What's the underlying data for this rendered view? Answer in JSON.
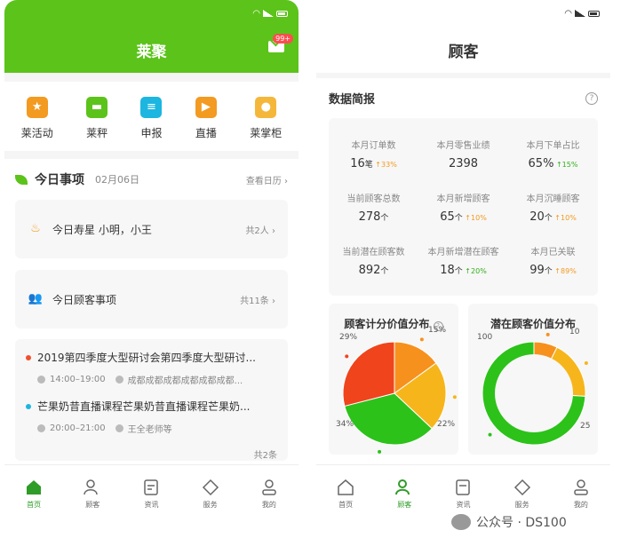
{
  "left": {
    "title": "莱聚",
    "mail_badge": "99+",
    "apps": [
      {
        "label": "莱活动",
        "icon": "star-icon",
        "color": "#f39a21"
      },
      {
        "label": "莱秤",
        "icon": "scale-icon",
        "color": "#5cc31a"
      },
      {
        "label": "申报",
        "icon": "clipboard-icon",
        "color": "#1cb6e0"
      },
      {
        "label": "直播",
        "icon": "live-icon",
        "color": "#f39a21"
      },
      {
        "label": "莱掌柜",
        "icon": "user-icon",
        "color": "#f5b73a"
      }
    ],
    "today": {
      "title": "今日事项",
      "date": "02月06日",
      "more": "查看日历"
    },
    "birthday": {
      "label": "今日寿星 小明，小王",
      "count": "共2人"
    },
    "customer": {
      "label": "今日顾客事项",
      "count": "共11条"
    },
    "events": [
      {
        "title": "2019第四季度大型研讨会第四季度大型研讨...",
        "time": "14:00–19:00",
        "place": "成都成都成都成都成都成都...",
        "dot": "#f0502a"
      },
      {
        "title": "芒果奶昔直播课程芒果奶昔直播课程芒果奶...",
        "time": "20:00–21:00",
        "place": "王全老师等",
        "dot": "#1cb6e0"
      }
    ],
    "events_count": "共2条"
  },
  "right": {
    "title": "顾客",
    "section_title": "数据简报",
    "stats": [
      {
        "label": "本月订单数",
        "value": "16",
        "unit": "笔",
        "trend": "33%",
        "trend_color": "orange"
      },
      {
        "label": "本月零售业绩",
        "value": "2398",
        "unit": "",
        "trend": "",
        "trend_color": ""
      },
      {
        "label": "本月下单占比",
        "value": "65%",
        "unit": "",
        "trend": "15%",
        "trend_color": "green"
      },
      {
        "label": "当前顾客总数",
        "value": "278",
        "unit": "个",
        "trend": "",
        "trend_color": ""
      },
      {
        "label": "本月新增顾客",
        "value": "65",
        "unit": "个",
        "trend": "10%",
        "trend_color": "orange"
      },
      {
        "label": "本月沉睡顾客",
        "value": "20",
        "unit": "个",
        "trend": "10%",
        "trend_color": "orange"
      },
      {
        "label": "当前潜在顾客数",
        "value": "892",
        "unit": "个",
        "trend": "",
        "trend_color": ""
      },
      {
        "label": "本月新增潜在顾客",
        "value": "18",
        "unit": "个",
        "trend": "20%",
        "trend_color": "green"
      },
      {
        "label": "本月已关联",
        "value": "99",
        "unit": "个",
        "trend": "89%",
        "trend_color": "orange"
      }
    ],
    "pie": {
      "title": "顾客计分价值分布",
      "slices": [
        {
          "label": "15%",
          "value": 15,
          "color": "#f7911d"
        },
        {
          "label": "22%",
          "value": 22,
          "color": "#f7b51c"
        },
        {
          "label": "34%",
          "value": 34,
          "color": "#2cc21a"
        },
        {
          "label": "29%",
          "value": 29,
          "color": "#f0441c"
        }
      ]
    },
    "donut": {
      "title": "潜在顾客价值分布",
      "slices": [
        {
          "label": "10",
          "value": 10,
          "color": "#f7911d"
        },
        {
          "label": "25",
          "value": 25,
          "color": "#f7b51c"
        },
        {
          "label": "100",
          "value": 100,
          "color": "#2cc21a"
        }
      ]
    }
  },
  "tabs": [
    "首页",
    "顾客",
    "资讯",
    "服务",
    "我的"
  ],
  "watermark": "公众号 · DS100"
}
